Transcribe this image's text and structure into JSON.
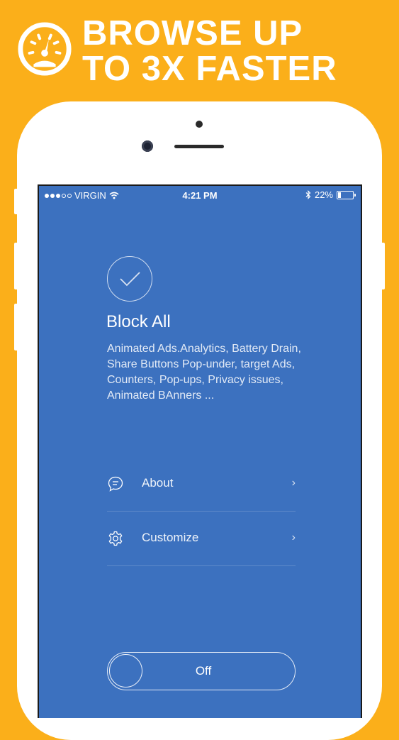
{
  "banner": {
    "line1": "BROWSE UP",
    "line2": "TO 3X FASTER",
    "icon": "speedometer-icon"
  },
  "status_bar": {
    "carrier": "VIRGIN",
    "time": "4:21 PM",
    "battery_percent": "22%",
    "battery_level": 0.22
  },
  "main": {
    "title": "Block All",
    "description": "Animated Ads.Analytics, Battery Drain, Share Buttons Pop-under, target Ads, Counters, Pop-ups, Privacy issues, Animated BAnners ..."
  },
  "menu": [
    {
      "label": "About",
      "icon": "chat-bubble-icon"
    },
    {
      "label": "Customize",
      "icon": "gear-icon"
    }
  ],
  "toggle": {
    "label": "Off",
    "state": "off"
  },
  "colors": {
    "background": "#FBAF1A",
    "screen": "#3C71BF",
    "text": "#FFFFFF"
  }
}
